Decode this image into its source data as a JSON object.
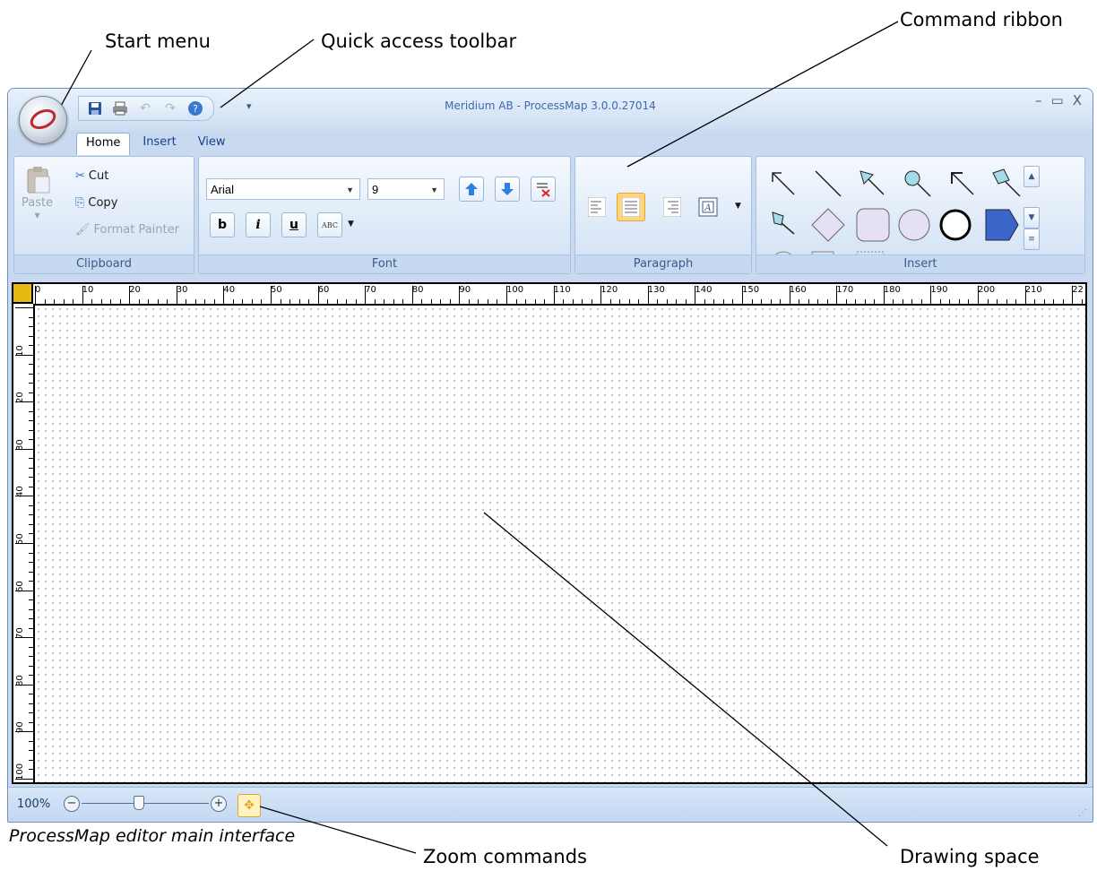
{
  "annotations": {
    "start_menu": "Start menu",
    "quick_access_toolbar": "Quick access toolbar",
    "command_ribbon": "Command ribbon",
    "zoom_commands": "Zoom commands",
    "drawing_space": "Drawing space",
    "caption": "ProcessMap editor main interface"
  },
  "window": {
    "title": "Meridium AB - ProcessMap 3.0.0.27014",
    "controls": [
      "–",
      "▭",
      "X"
    ]
  },
  "quick_access": {
    "icons": [
      "save-icon",
      "print-icon",
      "undo-icon",
      "redo-icon",
      "help-icon"
    ],
    "more": "▾"
  },
  "tabs": [
    "Home",
    "Insert",
    "View"
  ],
  "ribbon": {
    "clipboard": {
      "label": "Clipboard",
      "paste": "Paste",
      "cut": "Cut",
      "copy": "Copy",
      "format_painter": "Format Painter"
    },
    "font": {
      "label": "Font",
      "family": "Arial",
      "size": "9",
      "bold": "b",
      "italic": "i",
      "underline": "u",
      "spell": "ABC"
    },
    "paragraph": {
      "label": "Paragraph"
    },
    "insert": {
      "label": "Insert"
    }
  },
  "ruler": {
    "h_ticks": [
      "0",
      "10",
      "20",
      "30",
      "40",
      "50",
      "60",
      "70",
      "80",
      "90",
      "100",
      "110",
      "120",
      "130",
      "140",
      "150",
      "160",
      "170",
      "180",
      "190",
      "200",
      "210",
      "22"
    ],
    "v_ticks": [
      "10",
      "20",
      "30",
      "40",
      "50",
      "60",
      "70",
      "80",
      "90",
      "100"
    ]
  },
  "status": {
    "zoom": "100%"
  },
  "colors": {
    "ribbon_bg": "#d0e0f5",
    "accent": "#3c5a87",
    "active_button": "#ffd47a"
  }
}
